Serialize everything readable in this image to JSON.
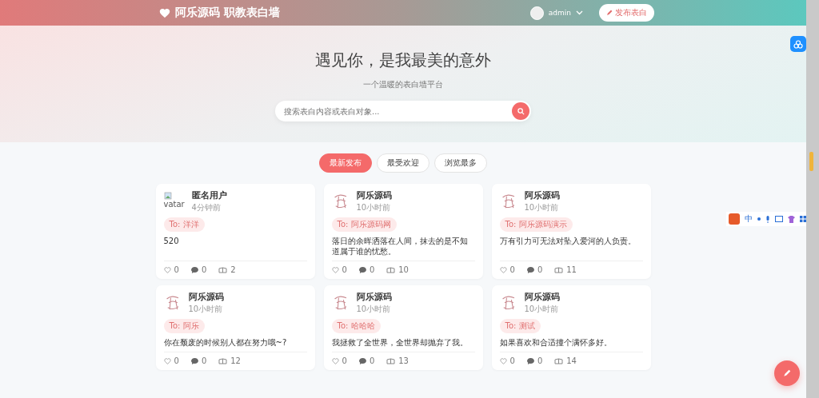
{
  "header": {
    "brand": "阿乐源码 职教表白墙",
    "user": "admin",
    "publish_button": "发布表白"
  },
  "hero": {
    "title": "遇见你，是我最美的意外",
    "subtitle": "一个温暖的表白墙平台",
    "search": {
      "placeholder": "搜索表白内容或表白对象..."
    }
  },
  "tabs": [
    {
      "label": "最新发布",
      "selected": true
    },
    {
      "label": "最受欢迎",
      "selected": false
    },
    {
      "label": "浏览最多",
      "selected": false
    }
  ],
  "cards": [
    {
      "avatar_alt": "vatar",
      "author": "匿名用户",
      "time": "4分钟前",
      "to": "To: 洋洋",
      "content": "520",
      "likes": "0",
      "comments": "0",
      "views": "2"
    },
    {
      "author": "阿乐源码",
      "time": "10小时前",
      "to": "To: 阿乐源码网",
      "content": "落日的余晖洒落在人间，抹去的是不知道属于谁的忧愁。",
      "likes": "0",
      "comments": "0",
      "views": "10"
    },
    {
      "author": "阿乐源码",
      "time": "10小时前",
      "to": "To: 阿乐源码演示",
      "content": "万有引力可无法对坠入爱河的人负责。",
      "likes": "0",
      "comments": "0",
      "views": "11"
    },
    {
      "author": "阿乐源码",
      "time": "10小时前",
      "to": "To: 阿乐",
      "content": "你在颓废的时候别人都在努力哦~?",
      "likes": "0",
      "comments": "0",
      "views": "12"
    },
    {
      "author": "阿乐源码",
      "time": "10小时前",
      "to": "To: 哈哈哈",
      "content": "我拯救了全世界，全世界却抛弃了我。",
      "likes": "0",
      "comments": "0",
      "views": "13"
    },
    {
      "author": "阿乐源码",
      "time": "10小时前",
      "to": "To: 测试",
      "content": "如果喜欢和合适撞个满怀多好。",
      "likes": "0",
      "comments": "0",
      "views": "14"
    }
  ],
  "ime_toolbar": {
    "mode": "中"
  }
}
